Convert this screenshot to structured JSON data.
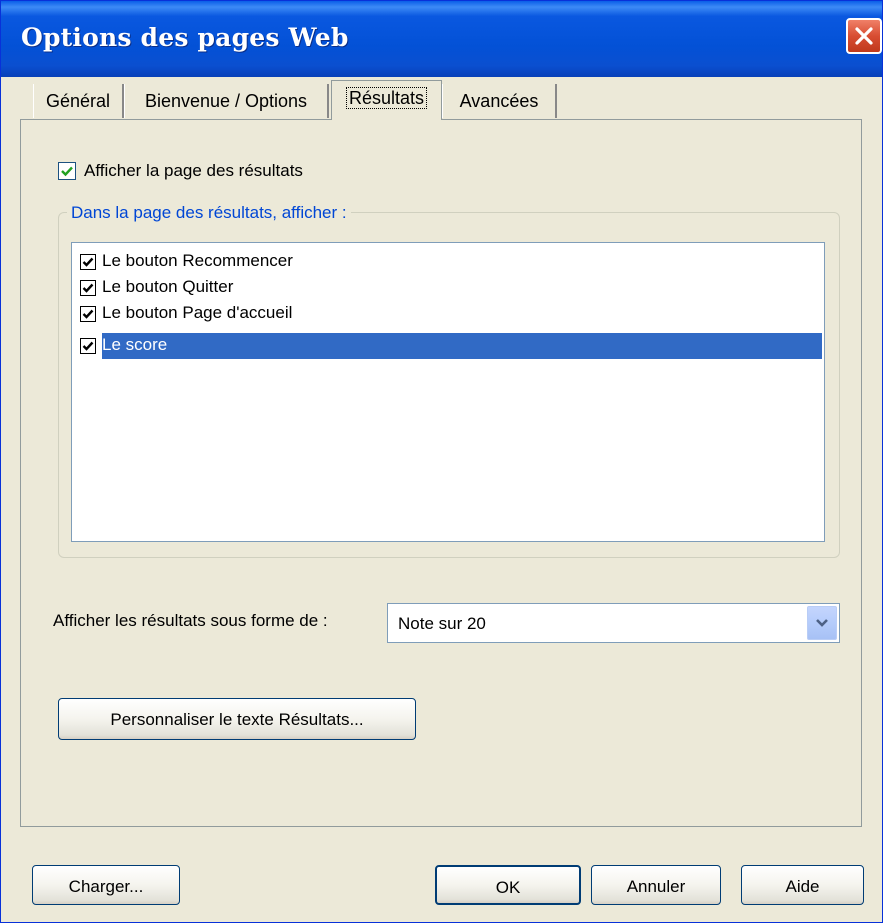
{
  "window": {
    "title": "Options des pages Web"
  },
  "tabs": [
    {
      "label": "Général",
      "active": false
    },
    {
      "label": "Bienvenue / Options",
      "active": false
    },
    {
      "label": "Résultats",
      "active": true
    },
    {
      "label": "Avancées",
      "active": false
    }
  ],
  "results_page": {
    "show_results_checkbox": {
      "label": "Afficher la page des résultats",
      "checked": true
    },
    "group_legend": "Dans la page des résultats, afficher :",
    "items": [
      {
        "label": "Le bouton Recommencer",
        "checked": true,
        "selected": false
      },
      {
        "label": "Le bouton Quitter",
        "checked": true,
        "selected": false
      },
      {
        "label": "Le bouton Page d'accueil",
        "checked": true,
        "selected": false
      },
      {
        "label": "Le score",
        "checked": true,
        "selected": true
      }
    ],
    "format_label": "Afficher les résultats sous forme de :",
    "format_value": "Note sur 20",
    "customize_button": "Personnaliser le texte Résultats..."
  },
  "footer": {
    "load_button": "Charger...",
    "ok_button": "OK",
    "cancel_button": "Annuler",
    "help_button": "Aide"
  },
  "colors": {
    "titlebar": "#0351d6",
    "selection": "#316ac5",
    "group_legend": "#0046d5",
    "face": "#ece9d8",
    "close": "#d84d32"
  }
}
